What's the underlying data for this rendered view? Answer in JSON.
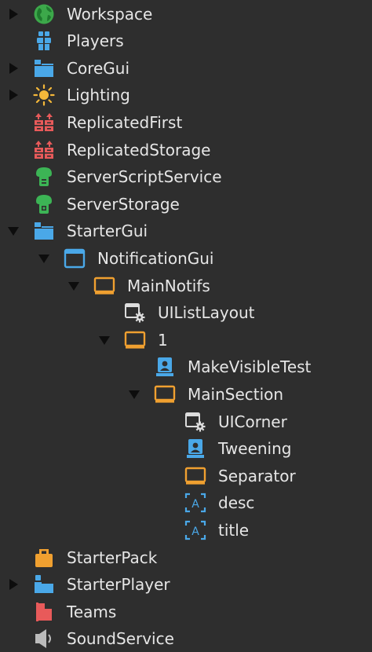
{
  "tree": {
    "items": [
      {
        "label": "Workspace",
        "icon": "globe-icon",
        "expand": "collapsed"
      },
      {
        "label": "Players",
        "icon": "players-icon",
        "expand": "none"
      },
      {
        "label": "CoreGui",
        "icon": "folder-blue-icon",
        "expand": "collapsed"
      },
      {
        "label": "Lighting",
        "icon": "sun-icon",
        "expand": "collapsed"
      },
      {
        "label": "ReplicatedFirst",
        "icon": "replicated-icon",
        "expand": "none"
      },
      {
        "label": "ReplicatedStorage",
        "icon": "replicated-icon",
        "expand": "none"
      },
      {
        "label": "ServerScriptService",
        "icon": "server-script-icon",
        "expand": "none"
      },
      {
        "label": "ServerStorage",
        "icon": "server-storage-icon",
        "expand": "none"
      },
      {
        "label": "StarterGui",
        "icon": "folder-blue-icon",
        "expand": "expanded"
      },
      {
        "label": "NotificationGui",
        "icon": "screen-gui-icon",
        "expand": "expanded"
      },
      {
        "label": "MainNotifs",
        "icon": "frame-icon",
        "expand": "expanded"
      },
      {
        "label": "UIListLayout",
        "icon": "ui-component-icon",
        "expand": "none"
      },
      {
        "label": "1",
        "icon": "frame-icon",
        "expand": "expanded"
      },
      {
        "label": "MakeVisibleTest",
        "icon": "local-script-icon",
        "expand": "none"
      },
      {
        "label": "MainSection",
        "icon": "frame-icon",
        "expand": "expanded"
      },
      {
        "label": "UICorner",
        "icon": "ui-component-icon",
        "expand": "none"
      },
      {
        "label": "Tweening",
        "icon": "local-script-icon",
        "expand": "none"
      },
      {
        "label": "Separator",
        "icon": "frame-icon",
        "expand": "none"
      },
      {
        "label": "desc",
        "icon": "text-label-icon",
        "expand": "none"
      },
      {
        "label": "title",
        "icon": "text-label-icon",
        "expand": "none"
      },
      {
        "label": "StarterPack",
        "icon": "starter-pack-icon",
        "expand": "none"
      },
      {
        "label": "StarterPlayer",
        "icon": "starter-player-icon",
        "expand": "collapsed"
      },
      {
        "label": "Teams",
        "icon": "teams-icon",
        "expand": "none"
      },
      {
        "label": "SoundService",
        "icon": "sound-service-icon",
        "expand": "none"
      }
    ]
  },
  "colors": {
    "background": "#2e2e2e",
    "text": "#e6e6e6",
    "arrow": "#0d0d0d",
    "folder_blue": "#4aa8e8",
    "frame_orange": "#f0a030",
    "replicated_red": "#e85a5a",
    "server_green": "#3cb455",
    "globe_green": "#3ca84a",
    "sun_yellow": "#f5b83a"
  }
}
